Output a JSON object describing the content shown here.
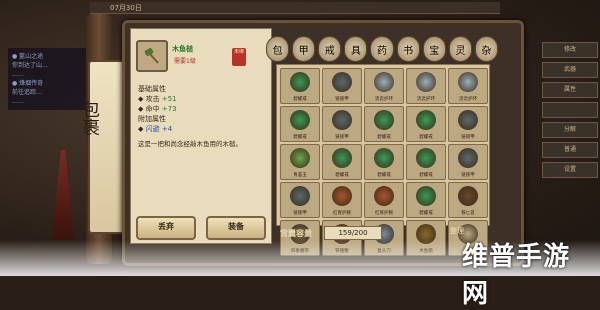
{
  "topbar": {
    "items": [
      "07月30日",
      "",
      ""
    ]
  },
  "left_panel": {
    "lines": [
      "● 藍山之途",
      "  你到达了山…",
      "  ……",
      "● 烽烟传奇",
      "  前往追踪…",
      "  ……"
    ]
  },
  "right_col": {
    "buttons": [
      "修改",
      "武器",
      "属性",
      "",
      "分解",
      "普通",
      "设置"
    ]
  },
  "scroll": {
    "title": "包裹"
  },
  "item": {
    "name": "木鱼槌",
    "req": "需要1级",
    "bound": "未绑"
  },
  "attrs": {
    "base_title": "基础属性",
    "base": [
      {
        "label": "攻击",
        "value": "+51"
      },
      {
        "label": "命中",
        "value": "+73"
      }
    ],
    "extra_title": "附加属性",
    "extra": [
      {
        "label": "闪避",
        "value": "+4"
      }
    ]
  },
  "desc": "这是一把和尚念经敲木鱼用的木槌。",
  "buttons": {
    "discard": "丢弃",
    "equip": "装备"
  },
  "capacity": {
    "label": "背囊容量",
    "value": "159/200"
  },
  "sort": {
    "label": "整理"
  },
  "watermark": "维普手游网",
  "grid": [
    {
      "label": "碧螺戒",
      "color": "#3a9a55"
    },
    {
      "label": "链锁甲",
      "color": "#5a6a6a"
    },
    {
      "label": "流云护环",
      "color": "#9ab0b8"
    },
    {
      "label": "流云护环",
      "color": "#9ab0b8"
    },
    {
      "label": "流云护环",
      "color": "#9ab0b8"
    },
    {
      "label": "碧螺戒",
      "color": "#3a9a55"
    },
    {
      "label": "链锁甲",
      "color": "#5a6a6a"
    },
    {
      "label": "碧螺戒",
      "color": "#3a9a55"
    },
    {
      "label": "碧螺戒",
      "color": "#3a9a55"
    },
    {
      "label": "链锁甲",
      "color": "#5a6a6a"
    },
    {
      "label": "青苔玉",
      "color": "#6aa84a"
    },
    {
      "label": "碧螺戒",
      "color": "#3a9a55"
    },
    {
      "label": "碧螺戒",
      "color": "#3a9a55"
    },
    {
      "label": "碧螺戒",
      "color": "#3a9a55"
    },
    {
      "label": "链锁甲",
      "color": "#5a6a6a"
    },
    {
      "label": "链锁甲",
      "color": "#5a6a6a"
    },
    {
      "label": "红胥护腕",
      "color": "#a8552c"
    },
    {
      "label": "红胥护腕",
      "color": "#a8552c"
    },
    {
      "label": "碧螺戒",
      "color": "#3a9a55"
    },
    {
      "label": "铁匕首",
      "color": "#6a4a2a"
    },
    {
      "label": "四象腰带",
      "color": "#7a6a4a"
    },
    {
      "label": "铁锥錾",
      "color": "#8a5a3a"
    },
    {
      "label": "复头刀",
      "color": "#7a8a9a"
    },
    {
      "label": "木鱼槌",
      "color": "#8a6a2a"
    },
    {
      "label": "",
      "color": "#bca982"
    }
  ],
  "tabs": [
    "包",
    "甲",
    "戒",
    "具",
    "药",
    "书",
    "宝",
    "灵",
    "杂"
  ]
}
